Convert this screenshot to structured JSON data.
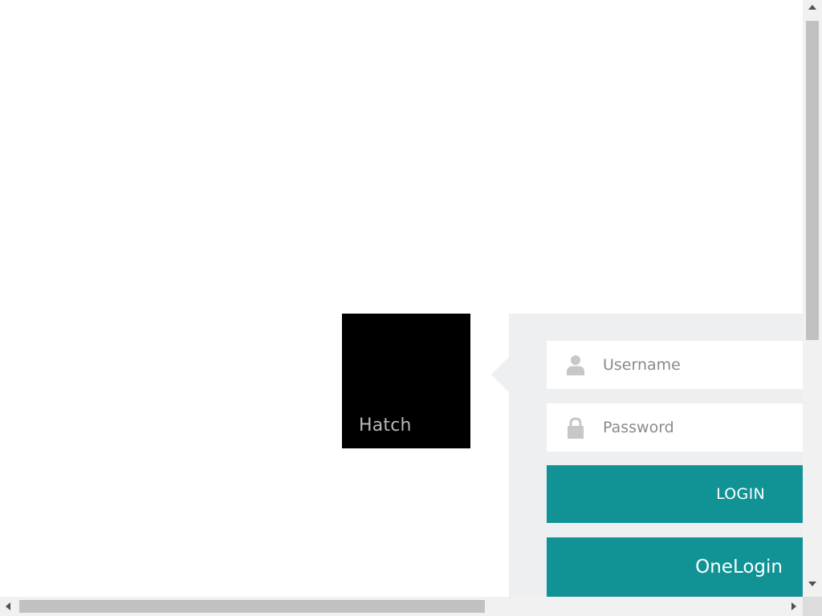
{
  "brand": {
    "name": "Hatch"
  },
  "login": {
    "username_placeholder": "Username",
    "password_placeholder": "Password",
    "login_label": "LOGIN",
    "onelogin_label": "OneLogin"
  },
  "icons": {
    "username": "user-icon",
    "password": "lock-icon"
  },
  "colors": {
    "accent": "#119396",
    "panel_bg": "#eeeff1",
    "brand_tile": "#000000",
    "brand_text": "#b9b9b9"
  }
}
